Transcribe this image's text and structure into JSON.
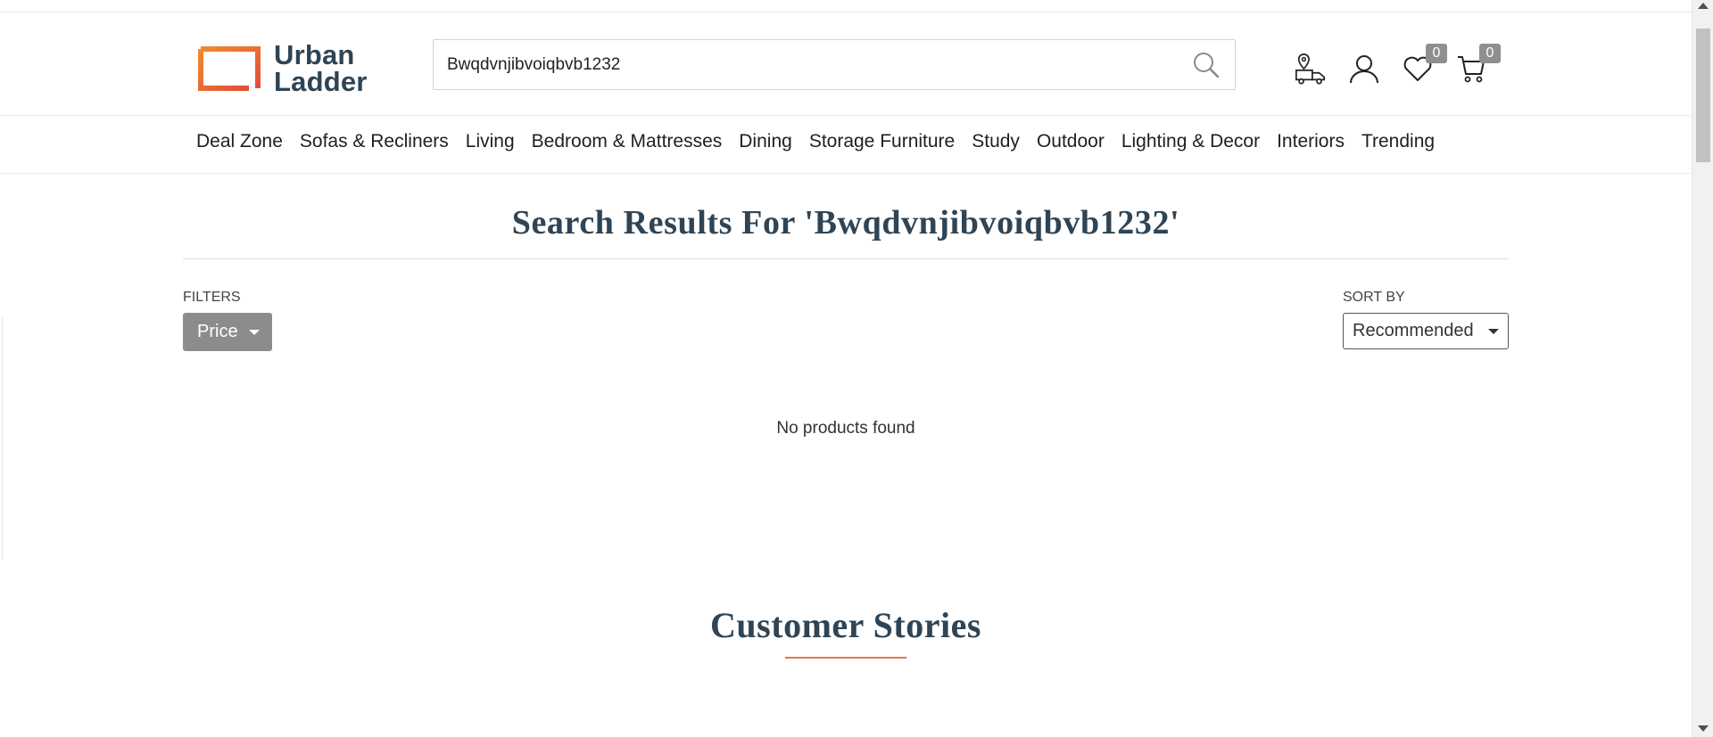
{
  "brand": {
    "name_line1": "Urban",
    "name_line2": "Ladder",
    "colors": {
      "text": "#2f4454",
      "gradient_start": "#f18a2c",
      "gradient_end": "#e44d3a"
    }
  },
  "search": {
    "value": "Bwqdvnjibvoiqbvb1232",
    "icon": "search-icon"
  },
  "header_icons": [
    {
      "name": "delivery-location-icon"
    },
    {
      "name": "account-icon"
    },
    {
      "name": "wishlist-icon",
      "count": "0"
    },
    {
      "name": "cart-icon",
      "count": "0"
    }
  ],
  "nav": {
    "items": [
      "Deal Zone",
      "Sofas & Recliners",
      "Living",
      "Bedroom & Mattresses",
      "Dining",
      "Storage Furniture",
      "Study",
      "Outdoor",
      "Lighting & Decor",
      "Interiors",
      "Trending"
    ]
  },
  "results": {
    "title": "Search Results For 'Bwqdvnjibvoiqbvb1232'",
    "empty_message": "No products found"
  },
  "filters": {
    "label": "FILTERS",
    "price_label": "Price"
  },
  "sort": {
    "label": "SORT BY",
    "selected": "Recommended"
  },
  "stories": {
    "title": "Customer Stories",
    "accent_color": "#e0784a"
  }
}
